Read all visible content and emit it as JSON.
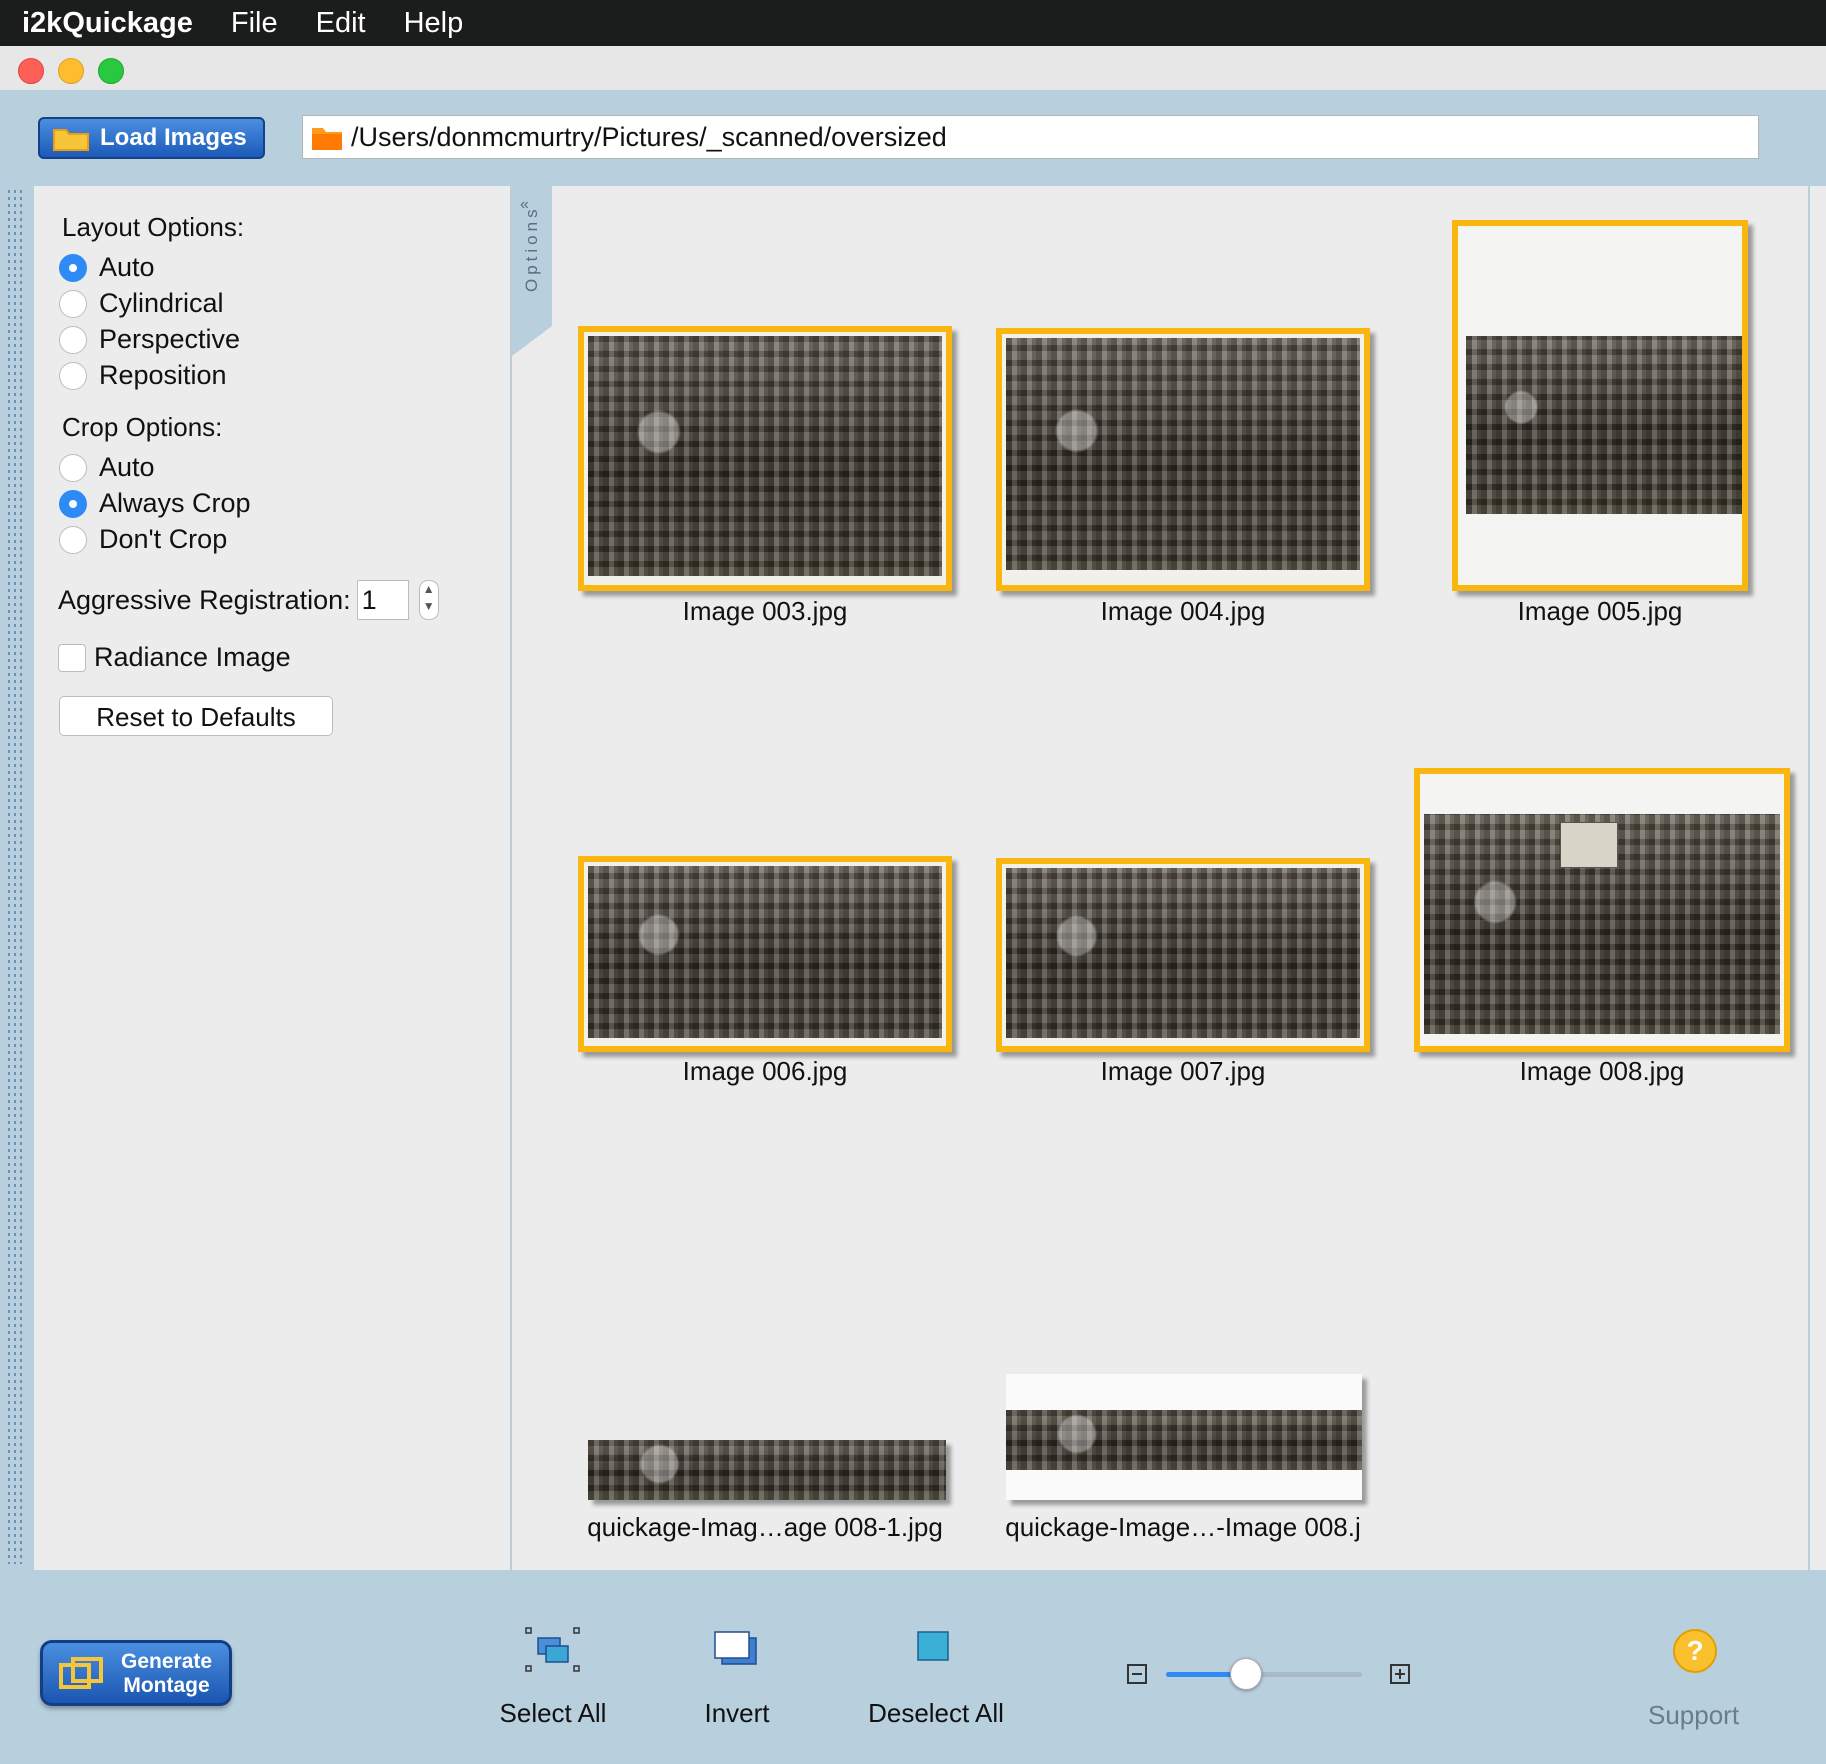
{
  "menubar": {
    "app_name": "i2kQuickage",
    "items": [
      "File",
      "Edit",
      "Help"
    ]
  },
  "toolbar": {
    "load_label": "Load Images",
    "path": "/Users/donmcmurtry/Pictures/_scanned/oversized"
  },
  "options": {
    "tab_label": "Options",
    "layout_heading": "Layout Options:",
    "layout_items": [
      "Auto",
      "Cylindrical",
      "Perspective",
      "Reposition"
    ],
    "layout_selected": "Auto",
    "crop_heading": "Crop Options:",
    "crop_items": [
      "Auto",
      "Always Crop",
      "Don't Crop"
    ],
    "crop_selected": "Always Crop",
    "aggressive_label": "Aggressive Registration:",
    "aggressive_value": "1",
    "radiance_label": "Radiance Image",
    "radiance_checked": false,
    "reset_label": "Reset to Defaults"
  },
  "gallery": {
    "items": [
      {
        "caption": "Image 003.jpg",
        "selected": true
      },
      {
        "caption": "Image 004.jpg",
        "selected": true
      },
      {
        "caption": "Image 005.jpg",
        "selected": true
      },
      {
        "caption": "Image 006.jpg",
        "selected": true
      },
      {
        "caption": "Image 007.jpg",
        "selected": true
      },
      {
        "caption": "Image 008.jpg",
        "selected": true
      },
      {
        "caption": "quickage-Imag…age 008-1.jpg",
        "selected": false
      },
      {
        "caption": "quickage-Image…-Image 008.j",
        "selected": false
      }
    ]
  },
  "bottom": {
    "generate_label_1": "Generate",
    "generate_label_2": "Montage",
    "select_all": "Select All",
    "invert": "Invert",
    "deselect_all": "Deselect All",
    "zoom_level": 0.4,
    "support": "Support"
  },
  "colors": {
    "selection": "#f8b60e",
    "accent": "#2e8af5",
    "toolbar_bg": "#b8cfde"
  }
}
